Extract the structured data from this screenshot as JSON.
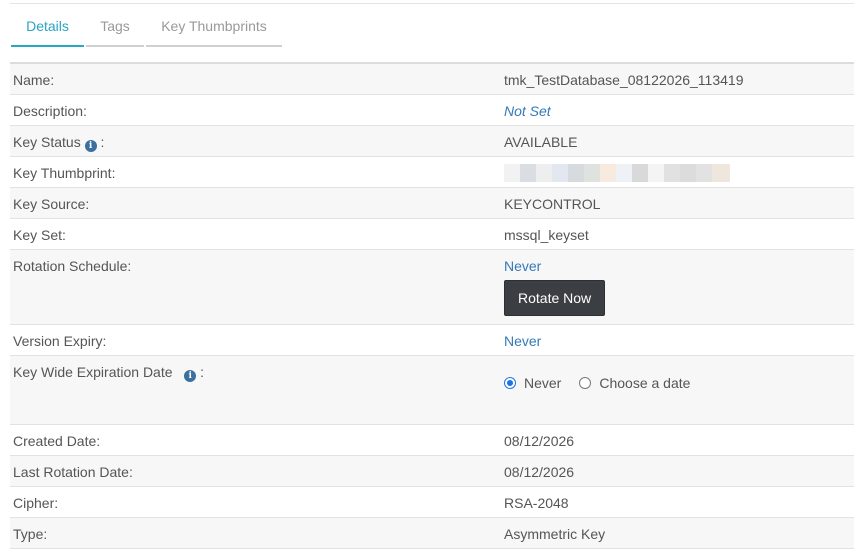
{
  "tabs": [
    {
      "label": "Details",
      "active": true
    },
    {
      "label": "Tags",
      "active": false
    },
    {
      "label": "Key Thumbprints",
      "active": false
    }
  ],
  "fields": {
    "name": {
      "label": "Name:",
      "value": "tmk_TestDatabase_08122026_113419"
    },
    "description": {
      "label": "Description:",
      "value": "Not Set"
    },
    "key_status": {
      "label": "Key Status",
      "suffix": ":",
      "value": "AVAILABLE"
    },
    "key_thumbprint": {
      "label": "Key Thumbprint:"
    },
    "key_source": {
      "label": "Key Source:",
      "value": "KEYCONTROL"
    },
    "key_set": {
      "label": "Key Set:",
      "value": "mssql_keyset"
    },
    "rotation_schedule": {
      "label": "Rotation Schedule:",
      "value": "Never",
      "button": "Rotate Now"
    },
    "version_expiry": {
      "label": "Version Expiry:",
      "value": "Never"
    },
    "key_wide_expiration": {
      "label": "Key Wide Expiration Date",
      "suffix": ":",
      "options": [
        "Never",
        "Choose a date"
      ],
      "selected": "Never"
    },
    "created_date": {
      "label": "Created Date:",
      "value": "08/12/2026"
    },
    "last_rotation": {
      "label": "Last Rotation Date:",
      "value": "08/12/2026"
    },
    "cipher": {
      "label": "Cipher:",
      "value": "RSA-2048"
    },
    "type": {
      "label": "Type:",
      "value": "Asymmetric Key"
    }
  },
  "colors": {
    "accent_tab": "#2aa5c4",
    "link": "#337ab7",
    "button_bg": "#3b3f44",
    "radio_selected": "#1a73e8"
  },
  "icons": {
    "info": "info-circle-icon"
  }
}
